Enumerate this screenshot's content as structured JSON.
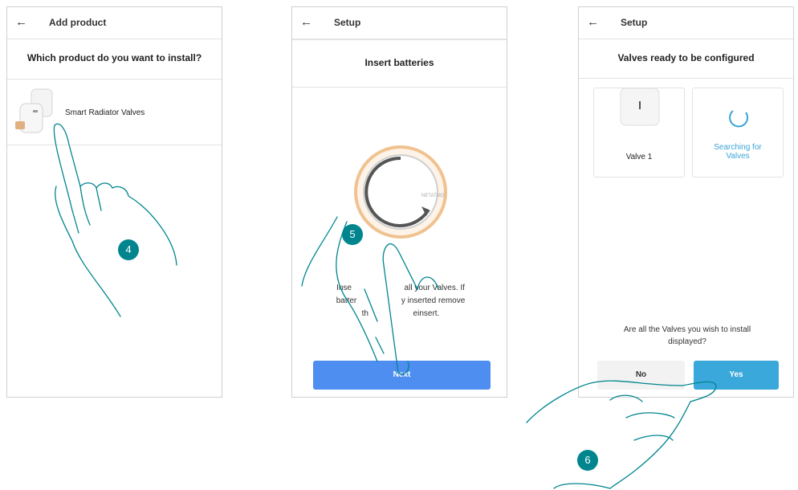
{
  "screens": [
    {
      "back_icon": "arrow-left-icon",
      "title": "Add product",
      "heading": "Which product do you want to install?",
      "product_name": "Smart Radiator Valves",
      "step": "4"
    },
    {
      "back_icon": "arrow-left-icon",
      "title": "Setup",
      "heading": "Insert batteries",
      "device_brand": "NETATMO",
      "instruction_line1": "Inse",
      "instruction_line1b": "all your Valves. If",
      "instruction_line2": "batter",
      "instruction_line2b": "y inserted remove",
      "instruction_line3": "th",
      "instruction_line3b": "einsert.",
      "next_label": "Next",
      "step": "5"
    },
    {
      "back_icon": "arrow-left-icon",
      "title": "Setup",
      "heading": "Valves ready to be configured",
      "valve_label": "Valve 1",
      "searching_label_line1": "Searching for",
      "searching_label_line2": "Valves",
      "question_line1": "Are all the Valves you wish to install",
      "question_line2": "displayed?",
      "no_label": "No",
      "yes_label": "Yes",
      "step": "6"
    }
  ],
  "colors": {
    "accent_teal": "#00858f",
    "next_blue": "#4d8ef0",
    "yes_blue": "#3aa8db",
    "search_blue": "#3aa4d6"
  }
}
